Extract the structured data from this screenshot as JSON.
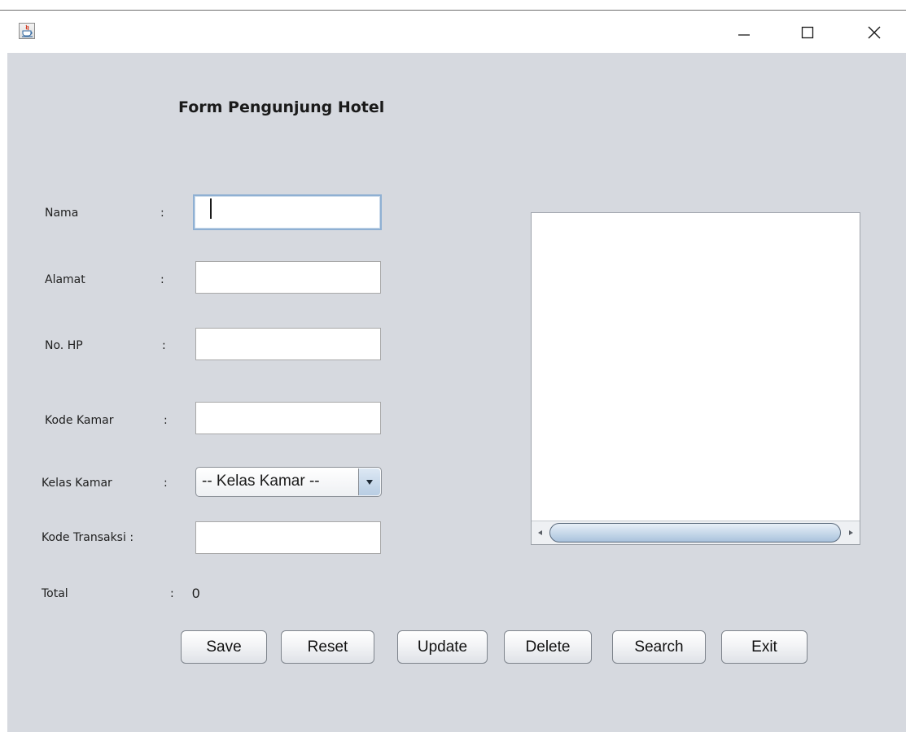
{
  "window": {
    "icon": "java-app-icon",
    "controls": {
      "minimize": "minimize-icon",
      "maximize": "maximize-icon",
      "close": "close-icon"
    }
  },
  "form": {
    "title": "Form Pengunjung Hotel",
    "fields": {
      "nama": {
        "label": "Nama",
        "colon": ":",
        "value": ""
      },
      "alamat": {
        "label": "Alamat",
        "colon": ":",
        "value": ""
      },
      "no_hp": {
        "label": "No. HP",
        "colon": ":",
        "value": ""
      },
      "kode_kamar": {
        "label": "Kode Kamar",
        "colon": ":",
        "value": ""
      },
      "kelas_kamar": {
        "label": "Kelas Kamar",
        "colon": ":",
        "selected": "-- Kelas Kamar --"
      },
      "kode_transaksi": {
        "label": "Kode Transaksi",
        "colon": ":",
        "value": ""
      },
      "total": {
        "label": "Total",
        "colon": ":",
        "value": "0"
      }
    },
    "buttons": {
      "save": "Save",
      "reset": "Reset",
      "update": "Update",
      "delete": "Delete",
      "search": "Search",
      "exit": "Exit"
    }
  },
  "colors": {
    "panel_background": "#d6d9df",
    "focus_border": "#8fb0d3",
    "scroll_thumb": "#c8d9ea"
  }
}
